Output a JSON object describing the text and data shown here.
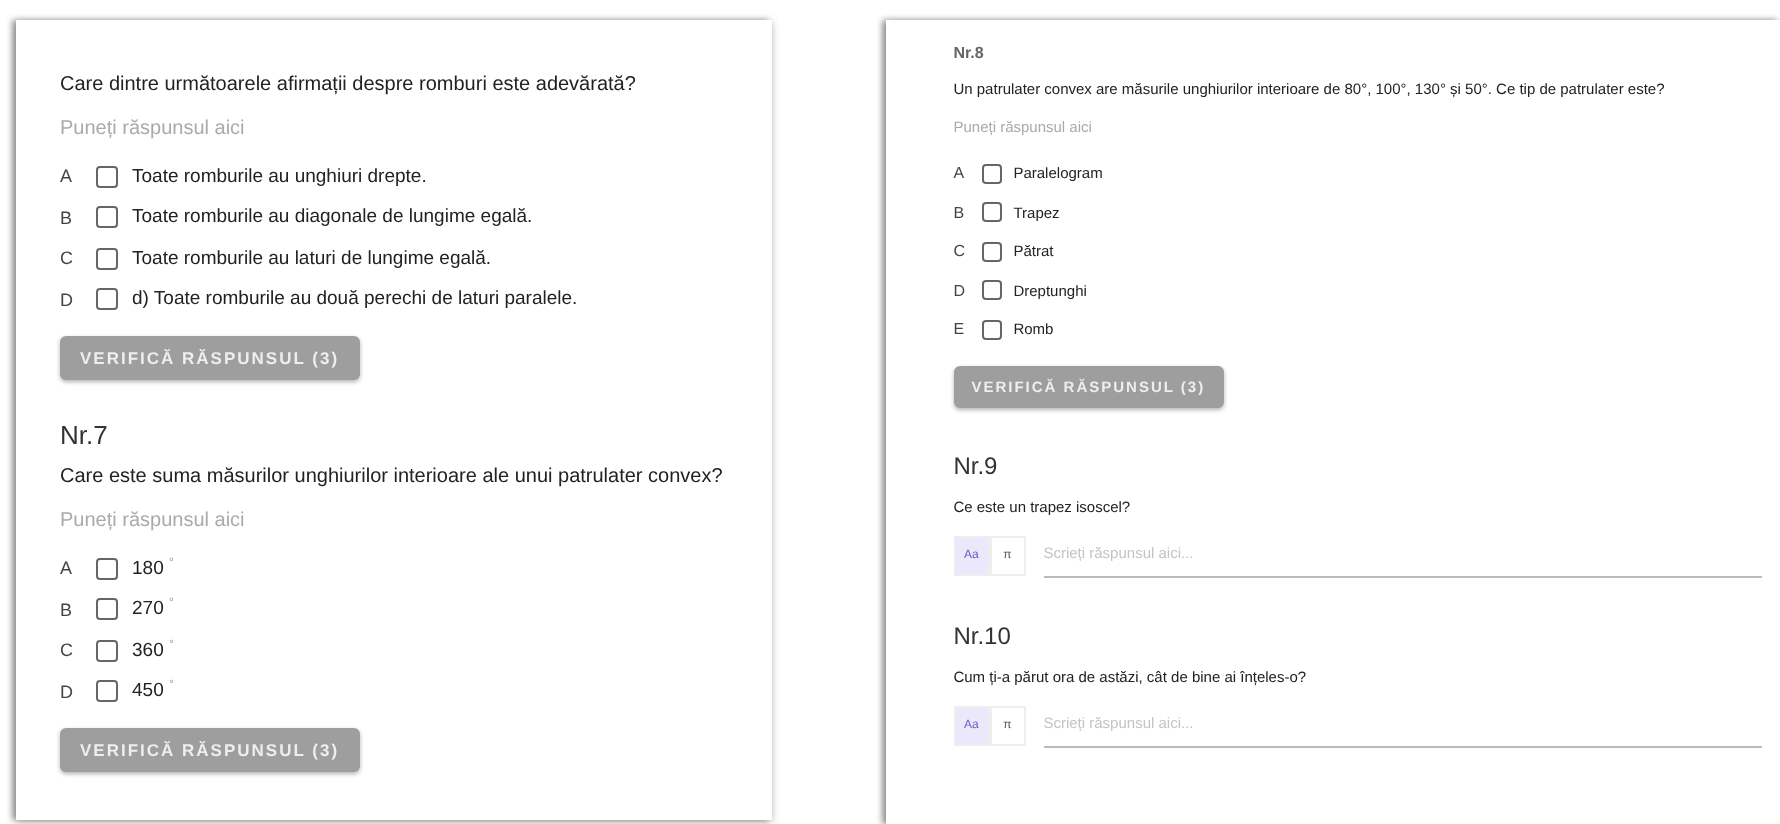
{
  "panels": [
    {
      "questions": [
        {
          "kind": "choice",
          "text": "Care dintre următoarele afirmații despre romburi este adevărată?",
          "placeholder": "Puneți răspunsul aici",
          "options": [
            {
              "letter": "A",
              "text": "Toate romburile au unghiuri drepte.",
              "checked": false
            },
            {
              "letter": "B",
              "text": "Toate romburile au diagonale de lungime egală.",
              "checked": false
            },
            {
              "letter": "C",
              "text": "Toate romburile au laturi de lungime egală.",
              "checked": false
            },
            {
              "letter": "D",
              "text": "d) Toate romburile au două perechi de laturi paralele.",
              "checked": false
            }
          ],
          "button": "VERIFICĂ RĂSPUNSUL (3)"
        },
        {
          "kind": "choice",
          "number": "Nr.7",
          "text": "Care este suma măsurilor unghiurilor interioare ale unui patrulater convex?",
          "placeholder": "Puneți răspunsul aici",
          "options": [
            {
              "letter": "A",
              "text": "180 $^{°}$",
              "checked": false
            },
            {
              "letter": "B",
              "text": "270 $^{°}$",
              "checked": false
            },
            {
              "letter": "C",
              "text": "360 $^{°}$",
              "checked": false
            },
            {
              "letter": "D",
              "text": "450 $^{°}$",
              "checked": false
            }
          ],
          "button": "VERIFICĂ RĂSPUNSUL (3)"
        }
      ]
    },
    {
      "questions": [
        {
          "kind": "choice",
          "number": "Nr.8",
          "text": "Un patrulater convex are măsurile unghiurilor interioare de 80°, 100°, 130° și 50°. Ce tip de patrulater este?",
          "placeholder": "Puneți răspunsul aici",
          "options": [
            {
              "letter": "A",
              "text": "Paralelogram",
              "checked": false
            },
            {
              "letter": "B",
              "text": "Trapez",
              "checked": false
            },
            {
              "letter": "C",
              "text": "Pătrat",
              "checked": false
            },
            {
              "letter": "D",
              "text": "Dreptunghi",
              "checked": false
            },
            {
              "letter": "E",
              "text": "Romb",
              "checked": false
            }
          ],
          "button": "VERIFICĂ RĂSPUNSUL (3)"
        },
        {
          "kind": "open",
          "number": "Nr.9",
          "text": "Ce este un trapez isoscel?",
          "modes": [
            {
              "label": "Aa",
              "selected": true
            },
            {
              "label": "π",
              "selected": false
            }
          ],
          "placeholder": "Scrieți răspunsul aici..."
        },
        {
          "kind": "open",
          "number": "Nr.10",
          "text": "Cum ți-a părut ora de astăzi, cât de bine ai înțeles-o?",
          "modes": [
            {
              "label": "Aa",
              "selected": true
            },
            {
              "label": "π",
              "selected": false
            }
          ],
          "placeholder": "Scrieți răspunsul aici..."
        }
      ]
    }
  ]
}
